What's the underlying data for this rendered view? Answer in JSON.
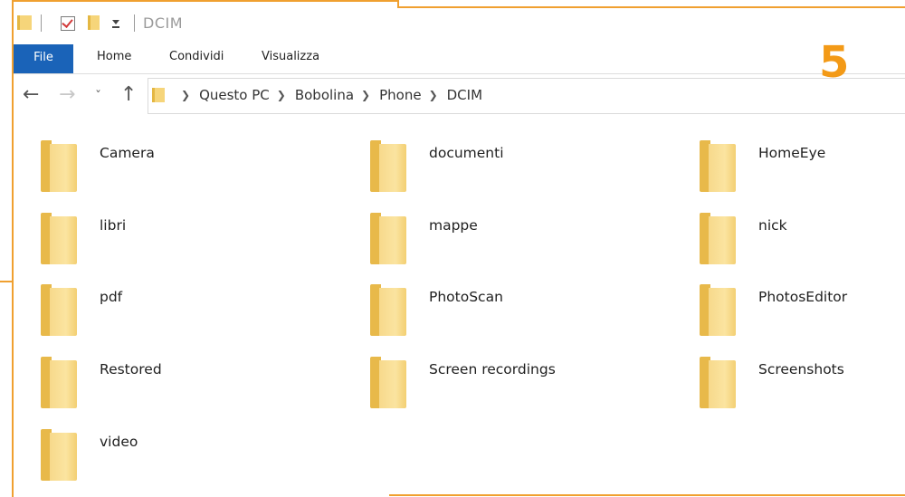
{
  "titlebar": {
    "title": "DCIM"
  },
  "ribbon": {
    "tabs": [
      {
        "label": "File"
      },
      {
        "label": "Home"
      },
      {
        "label": "Condividi"
      },
      {
        "label": "Visualizza"
      }
    ]
  },
  "overlay": {
    "step_number": "5",
    "accent_color": "#f39a17"
  },
  "navigation": {
    "breadcrumb": [
      "Questo PC",
      "Bobolina",
      "Phone",
      "DCIM"
    ]
  },
  "folders": [
    {
      "name": "Camera"
    },
    {
      "name": "documenti"
    },
    {
      "name": "HomeEye"
    },
    {
      "name": "libri"
    },
    {
      "name": "mappe"
    },
    {
      "name": "nick"
    },
    {
      "name": "pdf"
    },
    {
      "name": "PhotoScan"
    },
    {
      "name": "PhotosEditor"
    },
    {
      "name": "Restored"
    },
    {
      "name": "Screen recordings"
    },
    {
      "name": "Screenshots"
    },
    {
      "name": "video"
    }
  ]
}
